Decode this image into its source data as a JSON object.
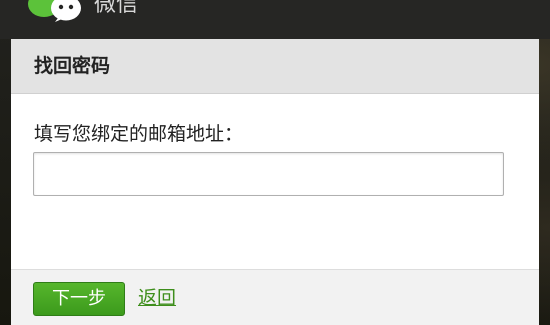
{
  "header": {
    "app_name": "微信",
    "logo_icon": "wechat-logo-icon"
  },
  "panel": {
    "title": "找回密码",
    "field_label": "填写您绑定的邮箱地址：",
    "email_value": ""
  },
  "footer": {
    "next_label": "下一步",
    "back_label": "返回"
  },
  "colors": {
    "accent_green": "#3c9a1c",
    "link_green": "#3e8e1c",
    "top_bar": "#262624"
  }
}
